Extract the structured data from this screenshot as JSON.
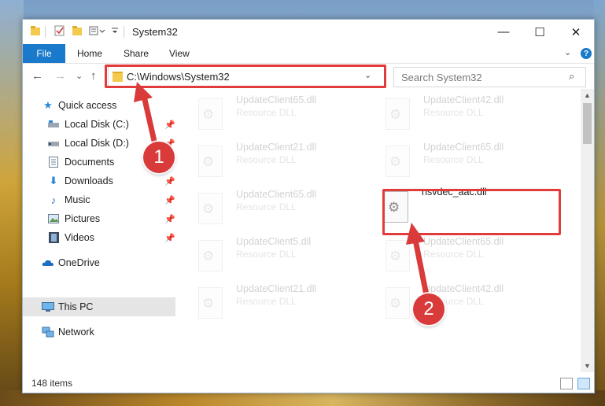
{
  "window": {
    "title": "System32"
  },
  "titlebar": {
    "buttons": {
      "minimize": "—",
      "maximize": "☐",
      "close": "✕"
    }
  },
  "ribbon": {
    "file": "File",
    "tabs": [
      "Home",
      "Share",
      "View"
    ],
    "help": "?"
  },
  "navbar": {
    "back": "←",
    "forward": "→",
    "recent": "⌄",
    "up": "↑",
    "address": "C:\\Windows\\System32",
    "search_placeholder": "Search System32"
  },
  "sidebar": {
    "items": [
      {
        "label": "Quick access",
        "icon": "star-icon"
      },
      {
        "label": "Local Disk (C:)",
        "icon": "drive-icon",
        "pinned": true
      },
      {
        "label": "Local Disk (D:)",
        "icon": "drive-icon",
        "pinned": true
      },
      {
        "label": "Documents",
        "icon": "documents-icon",
        "pinned": true
      },
      {
        "label": "Downloads",
        "icon": "downloads-icon",
        "pinned": true
      },
      {
        "label": "Music",
        "icon": "music-icon",
        "pinned": true
      },
      {
        "label": "Pictures",
        "icon": "pictures-icon",
        "pinned": true
      },
      {
        "label": "Videos",
        "icon": "videos-icon",
        "pinned": true
      },
      {
        "label": "OneDrive",
        "icon": "onedrive-icon"
      },
      {
        "label": "This PC",
        "icon": "pc-icon",
        "selected": true
      },
      {
        "label": "Network",
        "icon": "network-icon"
      }
    ]
  },
  "files": [
    {
      "name": "UpdateClient65.dll",
      "desc": "Resource DLL"
    },
    {
      "name": "UpdateClient42.dll",
      "desc": "Resource DLL"
    },
    {
      "name": "UpdateClient21.dll",
      "desc": "Resource DLL"
    },
    {
      "name": "UpdateClient65.dll",
      "desc": "Resource DLL"
    },
    {
      "name": "UpdateClient65.dll",
      "desc": "Resource DLL"
    },
    {
      "name": "nsvdec_aac.dll",
      "desc": ""
    },
    {
      "name": "UpdateClient5.dll",
      "desc": "Resource DLL"
    },
    {
      "name": "UpdateClient65.dll",
      "desc": "Resource DLL"
    },
    {
      "name": "UpdateClient21.dll",
      "desc": "Resource DLL"
    },
    {
      "name": "UpdateClient42.dll",
      "desc": "Resource DLL"
    }
  ],
  "status": {
    "count": "148 items"
  },
  "callouts": {
    "one": "1",
    "two": "2"
  },
  "colors": {
    "accent": "#1979ca",
    "highlight": "#e13b3b",
    "callout": "#d93a3a"
  }
}
